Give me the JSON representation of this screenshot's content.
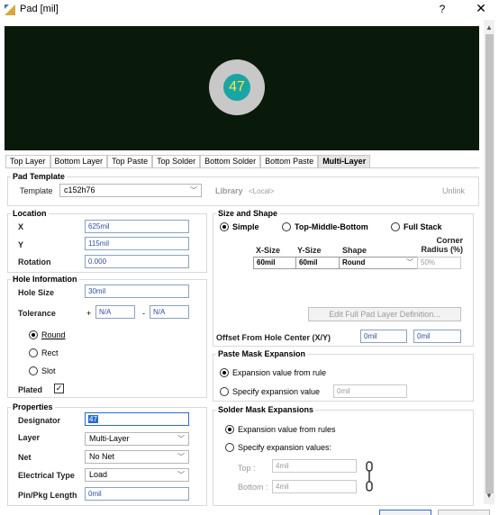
{
  "window": {
    "title": "Pad [mil]",
    "help": "?",
    "close": "✕"
  },
  "preview": {
    "designator": "47"
  },
  "tabs": [
    "Top Layer",
    "Bottom Layer",
    "Top Paste",
    "Top Solder",
    "Bottom Solder",
    "Bottom Paste",
    "Multi-Layer"
  ],
  "pad_template": {
    "title": "Pad Template",
    "template_label": "Template",
    "template_value": "c152h76",
    "library_label": "Library",
    "library_value": "<Local>",
    "unlink": "Unlink"
  },
  "location": {
    "title": "Location",
    "x_label": "X",
    "x_value": "625mil",
    "y_label": "Y",
    "y_value": "115mil",
    "rotation_label": "Rotation",
    "rotation_value": "0.000"
  },
  "hole": {
    "title": "Hole Information",
    "size_label": "Hole Size",
    "size_value": "30mil",
    "tolerance_label": "Tolerance",
    "plus": "+",
    "plus_value": "N/A",
    "minus": "-",
    "minus_value": "N/A",
    "shapes": [
      "Round",
      "Rect",
      "Slot"
    ],
    "plated_label": "Plated",
    "plated_check": "✓"
  },
  "size_shape": {
    "title": "Size and Shape",
    "options": [
      "Simple",
      "Top-Middle-Bottom",
      "Full Stack"
    ],
    "col_x": "X-Size",
    "col_y": "Y-Size",
    "col_shape": "Shape",
    "col_corner": "Corner Radius (%)",
    "row": {
      "x": "60mil",
      "y": "60mil",
      "shape": "Round",
      "corner": "50%"
    },
    "edit_button": "Edit Full Pad Layer Definition...",
    "offset_label": "Offset From Hole Center (X/Y)",
    "offset_x": "0mil",
    "offset_y": "0mil"
  },
  "paste_mask": {
    "title": "Paste Mask Expansion",
    "opt1": "Expansion value from rule",
    "opt2": "Specify expansion value",
    "value": "0mil"
  },
  "solder_mask": {
    "title": "Solder Mask Expansions",
    "opt1": "Expansion value from rules",
    "opt2": "Specify expansion values:",
    "top_label": "Top :",
    "top_value": "4mil",
    "bottom_label": "Bottom :",
    "bottom_value": "4mil"
  },
  "properties": {
    "title": "Properties",
    "designator_label": "Designator",
    "designator_value": "47",
    "layer_label": "Layer",
    "layer_value": "Multi-Layer",
    "net_label": "Net",
    "net_value": "No Net",
    "etype_label": "Electrical Type",
    "etype_value": "Load",
    "pin_label": "Pin/Pkg Length",
    "pin_value": "0mil"
  },
  "colors": {
    "accent": "#1aa5a5",
    "preview_bg": "#0a1a0a",
    "text_yellow": "#f5e64a"
  }
}
